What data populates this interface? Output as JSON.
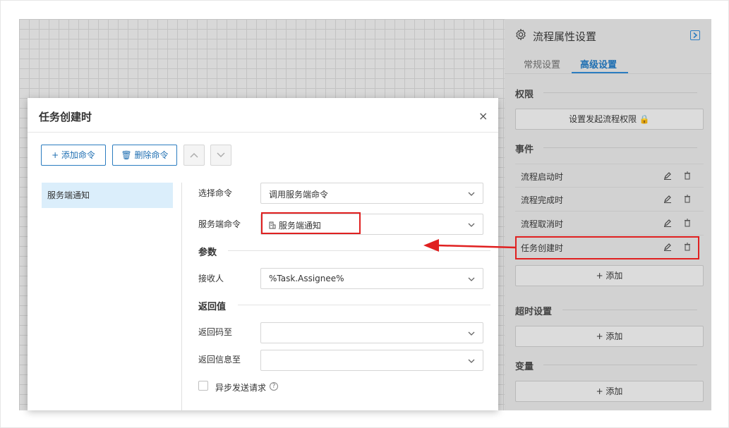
{
  "panel": {
    "title": "流程属性设置",
    "tabs": [
      {
        "label": "常规设置",
        "active": false
      },
      {
        "label": "高级设置",
        "active": true
      }
    ],
    "sections": {
      "permission": {
        "title": "权限",
        "button": "设置发起流程权限 🔒"
      },
      "events": {
        "title": "事件",
        "items": [
          "流程启动时",
          "流程完成时",
          "流程取消时",
          "任务创建时"
        ],
        "add": "+ 添加"
      },
      "timeout": {
        "title": "超时设置",
        "add": "+ 添加"
      },
      "variables": {
        "title": "变量",
        "add": "+ 添加"
      }
    }
  },
  "dialog": {
    "title": "任务创建时",
    "close": "×",
    "toolbar": {
      "add": "+ 添加命令",
      "delete": "🗑 删除命令"
    },
    "command_list": [
      "服务端通知"
    ],
    "form": {
      "select_command": {
        "label": "选择命令",
        "value": "调用服务端命令"
      },
      "server_command": {
        "label": "服务端命令",
        "value": "服务端通知"
      },
      "params_title": "参数",
      "receiver": {
        "label": "接收人",
        "value": "%Task.Assignee%"
      },
      "return_title": "返回值",
      "return_code": {
        "label": "返回码至",
        "value": ""
      },
      "return_message": {
        "label": "返回信息至",
        "value": ""
      },
      "async": {
        "label": "异步发送请求",
        "help": "?"
      }
    }
  },
  "colors": {
    "accent": "#2b7cc0",
    "highlight": "#e02020"
  }
}
